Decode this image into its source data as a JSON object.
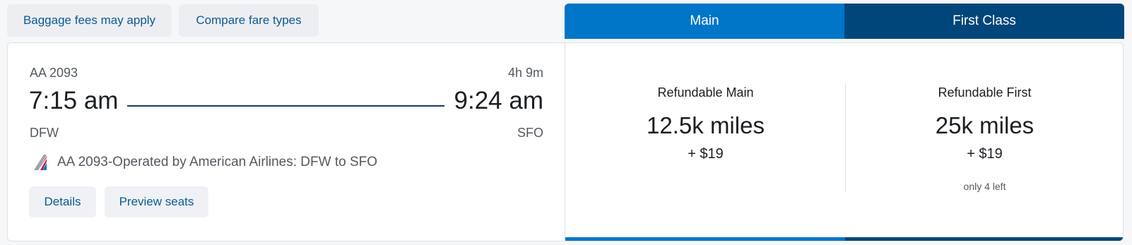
{
  "toolbar": {
    "baggage_label": "Baggage fees may apply",
    "compare_label": "Compare fare types"
  },
  "tabs": {
    "main": "Main",
    "first": "First Class"
  },
  "flight": {
    "number": "AA 2093",
    "duration": "4h 9m",
    "depart_time": "7:15 am",
    "arrive_time": "9:24 am",
    "origin": "DFW",
    "destination": "SFO",
    "operated_by": "AA 2093-Operated by American Airlines: DFW to SFO",
    "airline_icon": "american-airlines-logo-icon",
    "details_label": "Details",
    "preview_label": "Preview seats"
  },
  "fares": {
    "main": {
      "name": "Refundable Main",
      "miles": "12.5k miles",
      "tax": "+ $19"
    },
    "first": {
      "name": "Refundable First",
      "miles": "25k miles",
      "tax": "+ $19",
      "note": "only 4 left"
    }
  },
  "colors": {
    "main_blue": "#0076c8",
    "first_navy": "#00467a",
    "link_blue": "#0c5a96"
  }
}
